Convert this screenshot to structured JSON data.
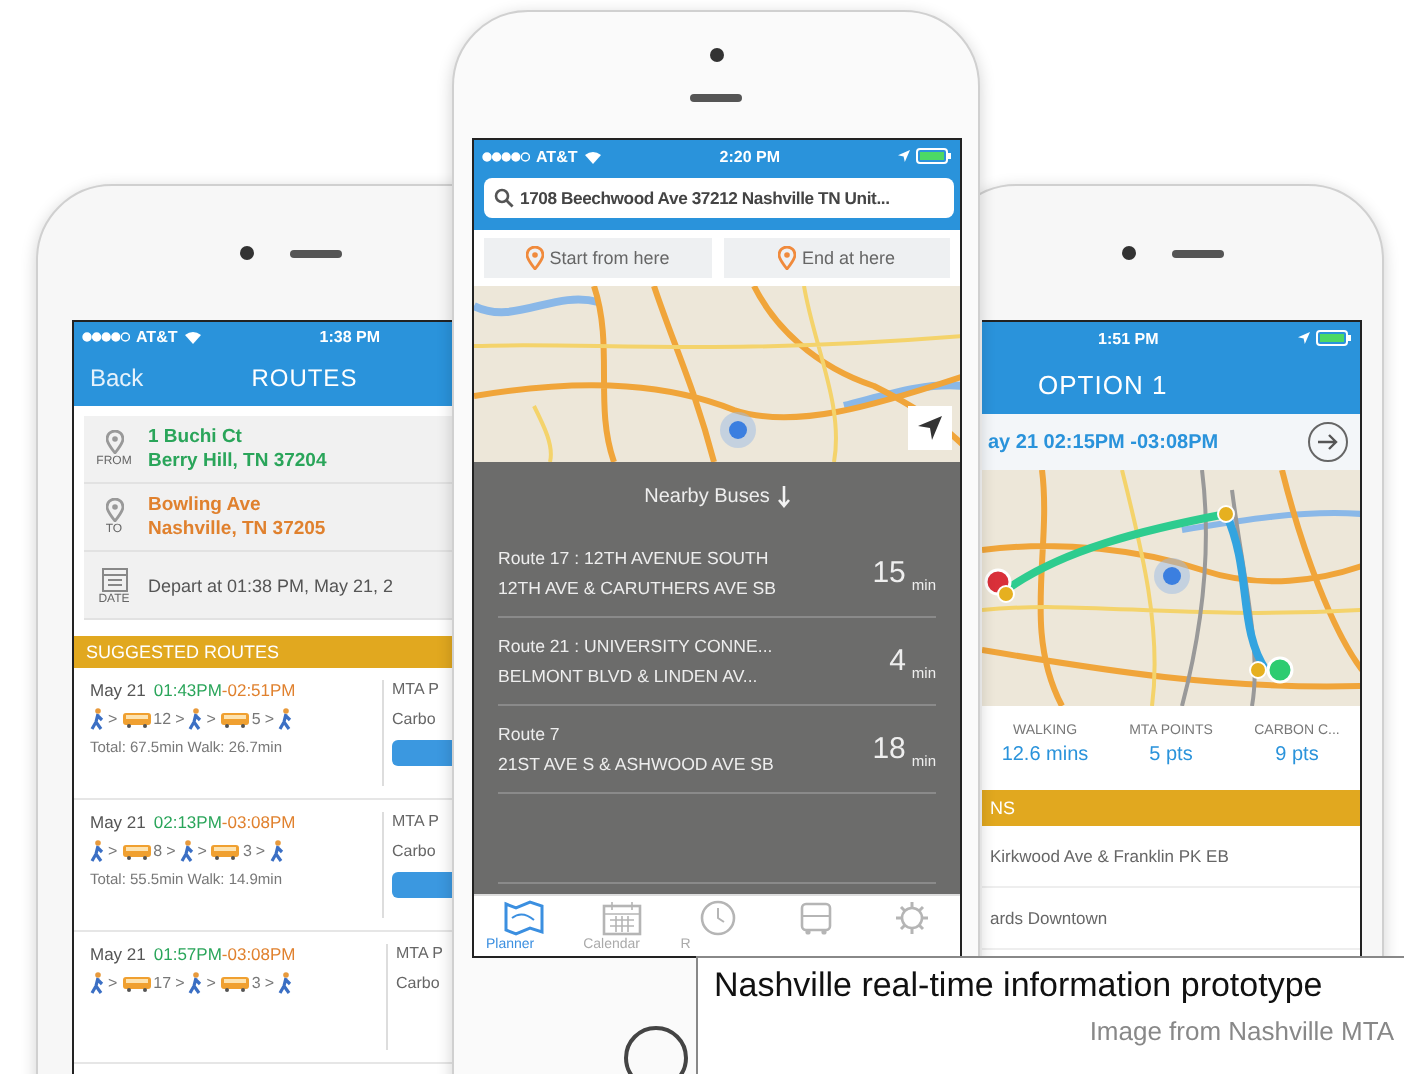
{
  "routes_screen": {
    "status": {
      "carrier": "AT&T",
      "time": "1:38 PM"
    },
    "header": {
      "back": "Back",
      "title": "ROUTES"
    },
    "trip": [
      {
        "kind": "from",
        "label": "FROM",
        "lines": [
          "1 Buchi Ct",
          "Berry Hill, TN 37204"
        ]
      },
      {
        "kind": "to",
        "label": "TO",
        "lines": [
          "Bowling Ave",
          "Nashville, TN 37205"
        ]
      },
      {
        "kind": "date",
        "label": "DATE",
        "lines": [
          "Depart at 01:38 PM, May 21, 2"
        ]
      }
    ],
    "section": "SUGGESTED ROUTES",
    "separator": ">",
    "routes": [
      {
        "date": "May 21",
        "start": "01:43PM",
        "end": "-02:51PM",
        "steps": [
          {
            "kind": "walk"
          },
          {
            "kind": "bus",
            "route": "12"
          },
          {
            "kind": "walk"
          },
          {
            "kind": "bus",
            "route": "5"
          },
          {
            "kind": "walk"
          }
        ],
        "total": "Total: 67.5min Walk: 26.7min",
        "points": "MTA P",
        "carbon": "Carbo"
      },
      {
        "date": "May 21",
        "start": "02:13PM",
        "end": "-03:08PM",
        "steps": [
          {
            "kind": "walk"
          },
          {
            "kind": "bus",
            "route": "8"
          },
          {
            "kind": "walk"
          },
          {
            "kind": "bus",
            "route": "3"
          },
          {
            "kind": "walk"
          }
        ],
        "total": "Total: 55.5min Walk: 14.9min",
        "points": "MTA P",
        "carbon": "Carbo"
      },
      {
        "date": "May 21",
        "start": "01:57PM",
        "end": "-03:08PM",
        "steps": [
          {
            "kind": "walk"
          },
          {
            "kind": "bus",
            "route": "17"
          },
          {
            "kind": "walk"
          },
          {
            "kind": "bus",
            "route": "3"
          },
          {
            "kind": "walk"
          }
        ],
        "points": "MTA P",
        "carbon": "Carbo"
      }
    ]
  },
  "planner_screen": {
    "status": {
      "carrier": "AT&T",
      "time": "2:20 PM"
    },
    "search": {
      "value": "1708 Beechwood Ave 37212 Nashville TN Unit..."
    },
    "actions": [
      {
        "label": "Start from here"
      },
      {
        "label": "End at here"
      }
    ],
    "nearby": {
      "title": "Nearby Buses",
      "buses": [
        {
          "route": "Route 17 : 12TH AVENUE SOUTH",
          "stop": "12TH AVE & CARUTHERS AVE SB",
          "minutes": "15",
          "unit": "min"
        },
        {
          "route": "Route 21 : UNIVERSITY CONNE...",
          "stop": "BELMONT BLVD & LINDEN AV...",
          "minutes": "4",
          "unit": "min"
        },
        {
          "route": "Route 7",
          "stop": "21ST AVE S & ASHWOOD AVE SB",
          "minutes": "18",
          "unit": "min"
        }
      ]
    },
    "tabs": [
      {
        "kind": "map",
        "label": "Planner",
        "selected": true
      },
      {
        "kind": "calendar",
        "label": "Calendar",
        "selected": false
      },
      {
        "kind": "clock",
        "label": "R",
        "selected": false
      },
      {
        "kind": "bus",
        "selected": false
      },
      {
        "kind": "gear",
        "selected": false
      }
    ]
  },
  "option_screen": {
    "status": {
      "time": "1:51 PM"
    },
    "title": "OPTION 1",
    "times": "ay 21 02:15PM -03:08PM",
    "stats": [
      {
        "label": "WALKING",
        "value": "12.6 mins"
      },
      {
        "label": "MTA POINTS",
        "value": "5 pts"
      },
      {
        "label": "CARBON C...",
        "value": "9 pts"
      }
    ],
    "section": "NS",
    "steps": [
      "Kirkwood Ave & Franklin PK EB",
      "ards Downtown"
    ]
  },
  "caption": {
    "title": "Nashville real-time information prototype",
    "credit": "Image from Nashville MTA"
  }
}
